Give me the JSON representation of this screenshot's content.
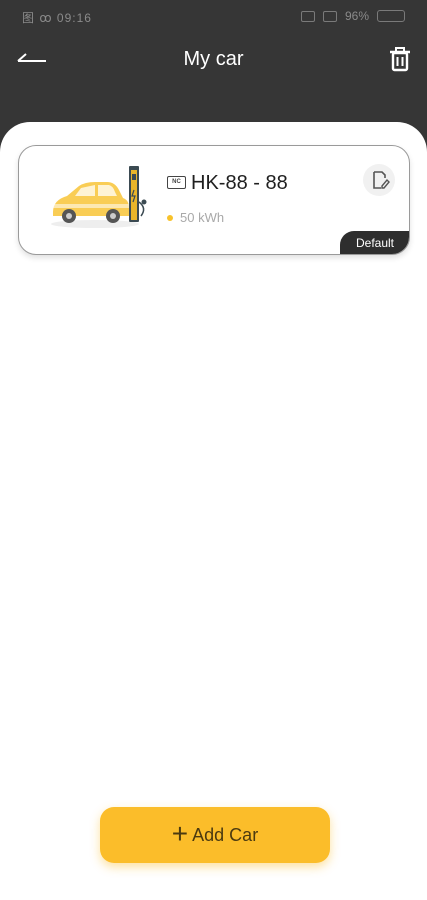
{
  "status_bar": {
    "left_text": "图 ꝏ 09:16",
    "right_text": "96%"
  },
  "header": {
    "title": "My car",
    "back_icon": "arrow-left-icon",
    "delete_icon": "trash-icon"
  },
  "cars": [
    {
      "plate_badge": "NC",
      "plate_number": "HK-88 - 88",
      "capacity": "50 kWh",
      "tag": "Default",
      "image_icon": "car-charging-illustration",
      "edit_icon": "edit-document-icon"
    }
  ],
  "actions": {
    "add_plus": "+",
    "add_label": "Add Car"
  },
  "colors": {
    "header_bg": "#363636",
    "accent": "#fbbd2a",
    "tag_bg": "#2e2e2e"
  }
}
